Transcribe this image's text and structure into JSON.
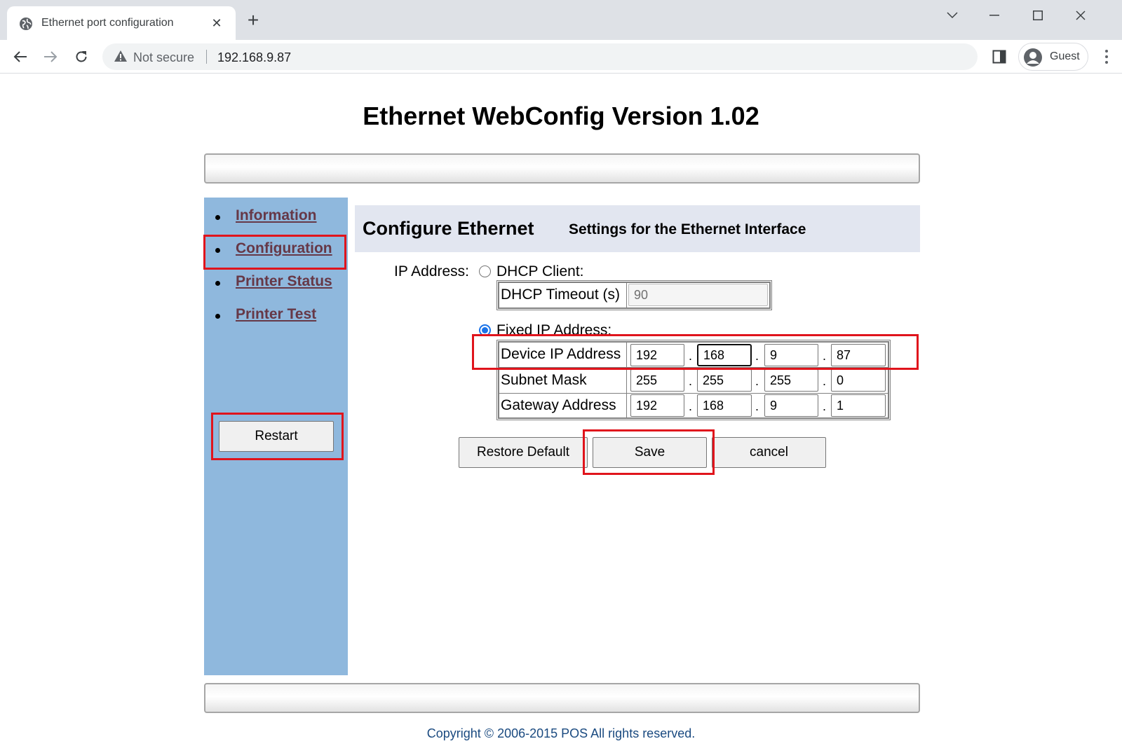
{
  "browser": {
    "tab_title": "Ethernet port configuration",
    "security_label": "Not secure",
    "url": "192.168.9.87",
    "profile_label": "Guest"
  },
  "page": {
    "title": "Ethernet WebConfig Version 1.02",
    "copyright": "Copyright © 2006-2015 POS All rights reserved."
  },
  "sidebar": {
    "items": [
      {
        "label": "Information"
      },
      {
        "label": "Configuration"
      },
      {
        "label": "Printer Status"
      },
      {
        "label": "Printer Test"
      }
    ],
    "restart_label": "Restart"
  },
  "content": {
    "title": "Configure Ethernet",
    "subtitle": "Settings for the Ethernet Interface",
    "ip_address_label": "IP Address:",
    "dhcp": {
      "label": "DHCP Client:",
      "selected": false,
      "timeout_label": "DHCP Timeout (s)",
      "timeout_value": "90"
    },
    "fixed": {
      "label": "Fixed IP Address:",
      "selected": true,
      "rows": [
        {
          "label": "Device IP Address",
          "octets": [
            "192",
            "168",
            "9",
            "87"
          ]
        },
        {
          "label": "Subnet Mask",
          "octets": [
            "255",
            "255",
            "255",
            "0"
          ]
        },
        {
          "label": "Gateway Address",
          "octets": [
            "192",
            "168",
            "9",
            "1"
          ]
        }
      ],
      "separator": "."
    },
    "buttons": {
      "restore": "Restore Default",
      "save": "Save",
      "cancel": "cancel"
    }
  },
  "colors": {
    "sidebar_bg": "#8fb8dd",
    "link": "#663847",
    "highlight": "#e0141c",
    "header_bg": "#e2e6f0"
  }
}
